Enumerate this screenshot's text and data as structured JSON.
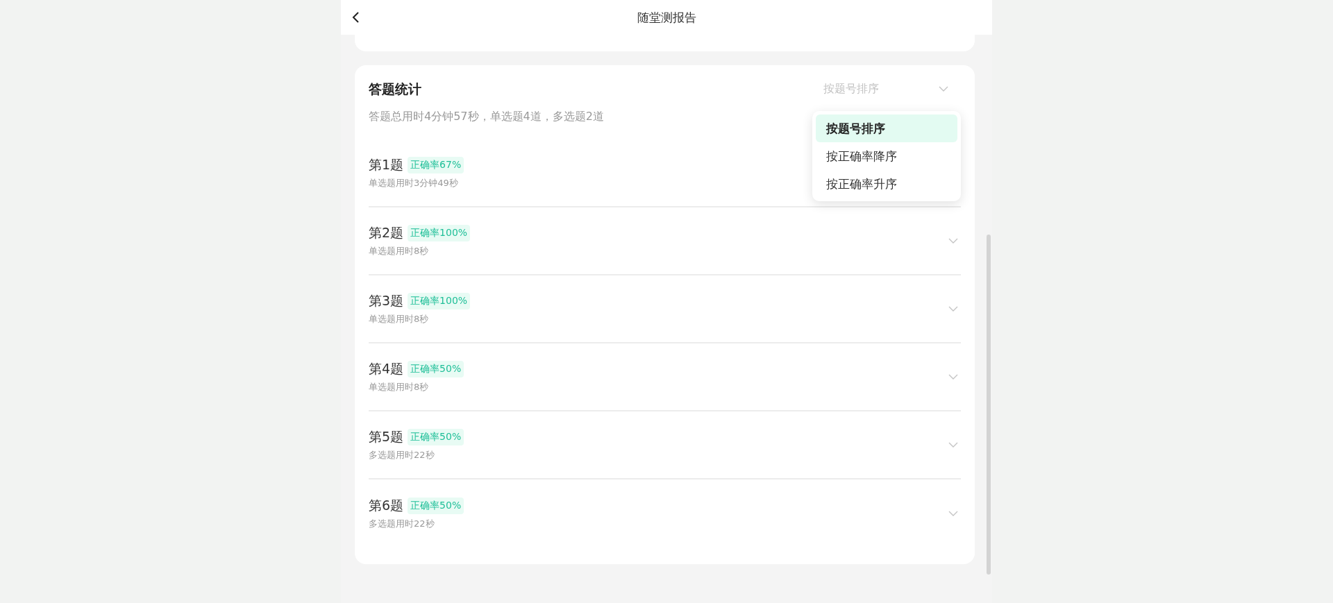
{
  "header": {
    "title": "随堂测报告"
  },
  "stats": {
    "title": "答题统计",
    "summary": "答题总用时4分钟57秒，单选题4道，多选题2道",
    "sort": {
      "value": "按题号排序",
      "expanded": true,
      "options": [
        {
          "label": "按题号排序",
          "selected": true
        },
        {
          "label": "按正确率降序",
          "selected": false
        },
        {
          "label": "按正确率升序",
          "selected": false
        }
      ]
    },
    "questions": [
      {
        "title": "第1题",
        "accuracy": "正确率67%",
        "detail": "单选题用时3分钟49秒"
      },
      {
        "title": "第2题",
        "accuracy": "正确率100%",
        "detail": "单选题用时8秒"
      },
      {
        "title": "第3题",
        "accuracy": "正确率100%",
        "detail": "单选题用时8秒"
      },
      {
        "title": "第4题",
        "accuracy": "正确率50%",
        "detail": "单选题用时8秒"
      },
      {
        "title": "第5题",
        "accuracy": "正确率50%",
        "detail": "多选题用时22秒"
      },
      {
        "title": "第6题",
        "accuracy": "正确率50%",
        "detail": "多选题用时22秒"
      }
    ]
  }
}
